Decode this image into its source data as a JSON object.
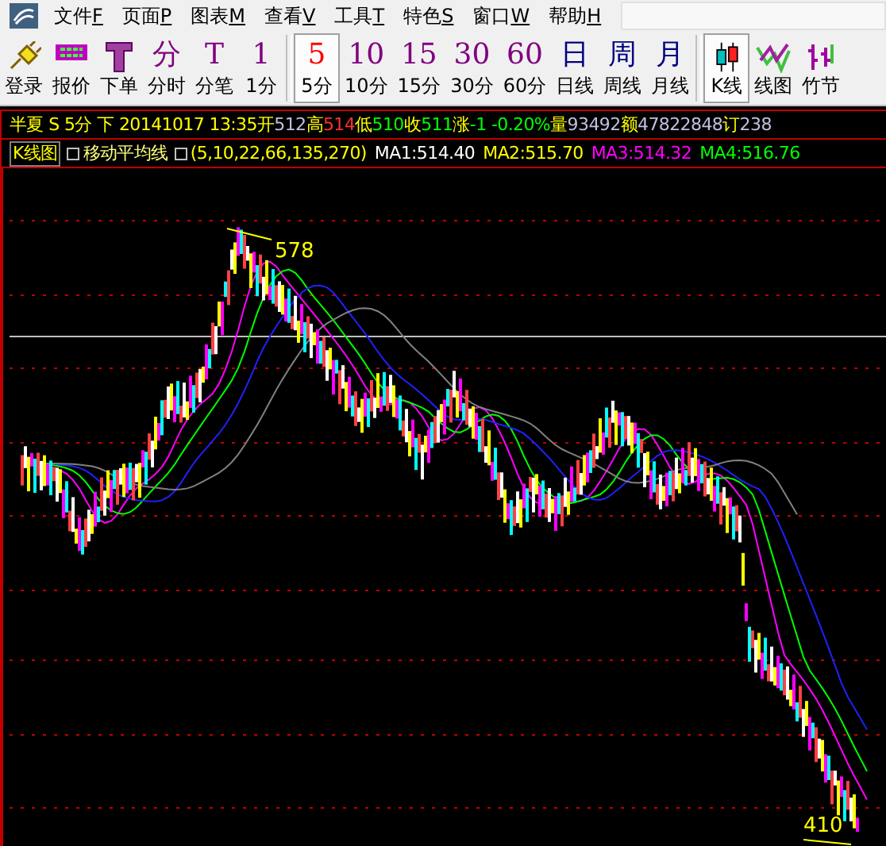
{
  "menu": [
    {
      "label": "文件",
      "key": "F"
    },
    {
      "label": "页面",
      "key": "P"
    },
    {
      "label": "图表",
      "key": "M"
    },
    {
      "label": "查看",
      "key": "V"
    },
    {
      "label": "工具",
      "key": "T"
    },
    {
      "label": "特色",
      "key": "S"
    },
    {
      "label": "窗口",
      "key": "W"
    },
    {
      "label": "帮助",
      "key": "H"
    }
  ],
  "toolbar": [
    [
      {
        "kind": "plug",
        "label": "登录",
        "selected": false
      },
      {
        "kind": "board",
        "label": "报价",
        "selected": false
      },
      {
        "kind": "tee",
        "label": "下单",
        "selected": false
      },
      {
        "kind": "glyph",
        "glyph": "分",
        "color": "#800080",
        "label": "分时",
        "selected": false
      },
      {
        "kind": "glyph",
        "glyph": "T",
        "color": "#800080",
        "label": "分笔",
        "selected": false
      },
      {
        "kind": "glyph",
        "glyph": "1",
        "color": "#800080",
        "label": "1分",
        "selected": false
      }
    ],
    [
      {
        "kind": "glyph",
        "glyph": "5",
        "color": "#ff0000",
        "label": "5分",
        "selected": true
      },
      {
        "kind": "glyph",
        "glyph": "10",
        "color": "#800080",
        "label": "10分",
        "selected": false
      },
      {
        "kind": "glyph",
        "glyph": "15",
        "color": "#800080",
        "label": "15分",
        "selected": false
      },
      {
        "kind": "glyph",
        "glyph": "30",
        "color": "#800080",
        "label": "30分",
        "selected": false
      },
      {
        "kind": "glyph",
        "glyph": "60",
        "color": "#800080",
        "label": "60分",
        "selected": false
      },
      {
        "kind": "glyph",
        "glyph": "日",
        "color": "#000080",
        "label": "日线",
        "selected": false
      },
      {
        "kind": "glyph",
        "glyph": "周",
        "color": "#000080",
        "label": "周线",
        "selected": false
      },
      {
        "kind": "glyph",
        "glyph": "月",
        "color": "#000080",
        "label": "月线",
        "selected": false
      }
    ],
    [
      {
        "kind": "candles",
        "label": "K线",
        "selected": true
      },
      {
        "kind": "lines",
        "label": "线图",
        "selected": false
      },
      {
        "kind": "bars",
        "label": "竹节",
        "selected": false
      }
    ]
  ],
  "quote_bar": [
    {
      "text": "半夏 S 5分 下 20141017 13:35",
      "color": "#ffff00"
    },
    {
      "text": "开",
      "color": "#ffff00"
    },
    {
      "text": "512",
      "color": "#c0c0e0"
    },
    {
      "text": "高",
      "color": "#ffff00"
    },
    {
      "text": "514",
      "color": "#ff3030"
    },
    {
      "text": "低",
      "color": "#ffff00"
    },
    {
      "text": "510",
      "color": "#00ff00"
    },
    {
      "text": "收",
      "color": "#ffff00"
    },
    {
      "text": "511",
      "color": "#00ff00"
    },
    {
      "text": "涨",
      "color": "#ffff00"
    },
    {
      "text": "-1 -0.20%",
      "color": "#00ff00"
    },
    {
      "text": "量",
      "color": "#ffff00"
    },
    {
      "text": "93492",
      "color": "#c0c0e0"
    },
    {
      "text": "额",
      "color": "#ffff00"
    },
    {
      "text": "47822848",
      "color": "#c0c0e0"
    },
    {
      "text": "订",
      "color": "#ffff00"
    },
    {
      "text": "238",
      "color": "#c0c0e0"
    }
  ],
  "indicator_bar": {
    "chart_type": "K线图",
    "indicator": "移动平均线",
    "params": "(5,10,22,66,135,270)",
    "values": [
      {
        "text": "MA1:514.40",
        "color": "#ffffff"
      },
      {
        "text": "MA2:515.70",
        "color": "#ffff00"
      },
      {
        "text": "MA3:514.32",
        "color": "#ff00ff"
      },
      {
        "text": "MA4:516.76",
        "color": "#00ff00"
      }
    ]
  },
  "chart": {
    "high_label": "578",
    "low_label": "410"
  }
}
